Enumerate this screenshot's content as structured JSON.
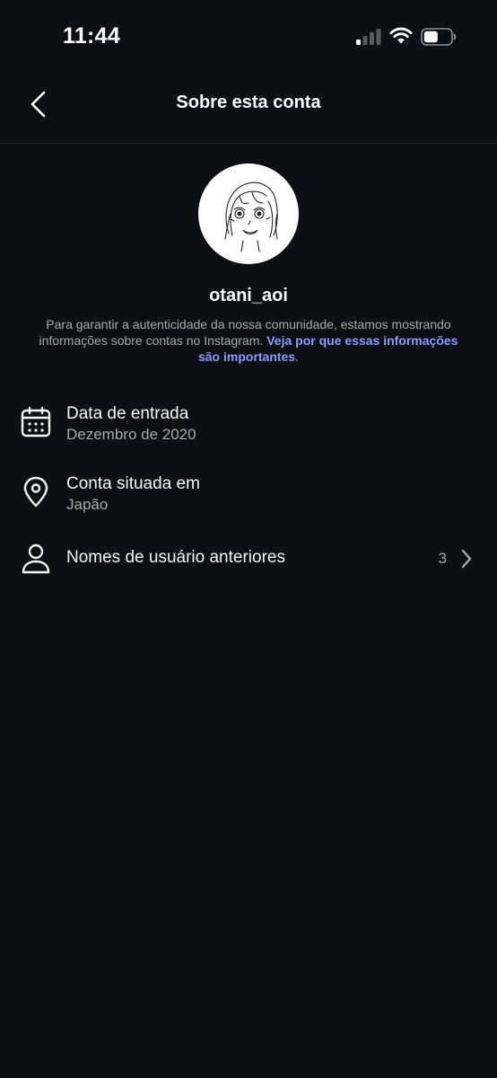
{
  "status_bar": {
    "time": "11:44",
    "icons": [
      "cellular-signal-icon",
      "wifi-icon",
      "battery-icon"
    ]
  },
  "header": {
    "back_icon": "chevron-left-icon",
    "title": "Sobre esta conta"
  },
  "profile": {
    "avatar_icon": "sketch-avatar",
    "username": "otani_aoi",
    "info_text": "Para garantir a autenticidade da nossa comunidade, estamos mostrando informações sobre contas no Instagram. ",
    "info_link": "Veja por que essas informações são importantes",
    "info_end": "."
  },
  "rows": [
    {
      "icon": "calendar-icon",
      "title": "Data de entrada",
      "subtitle": "Dezembro de 2020"
    },
    {
      "icon": "location-pin-icon",
      "title": "Conta situada em",
      "subtitle": "Japão"
    },
    {
      "icon": "user-icon",
      "title": "Nomes de usuário anteriores",
      "count": "3",
      "chevron": "chevron-right-icon"
    }
  ],
  "colors": {
    "background": "#0c1014",
    "primary_text": "#f5f5f5",
    "secondary_text": "#a8a8a8",
    "link": "#8a9dfb"
  }
}
